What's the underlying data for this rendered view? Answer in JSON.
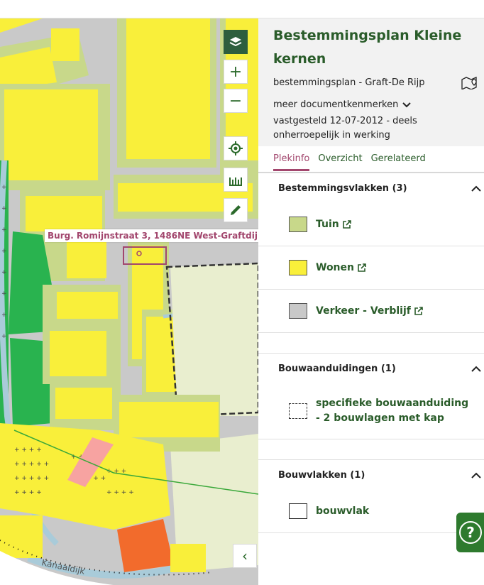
{
  "map": {
    "address_label": "Burg. Romijnstraat 3, 1486NE West-Graftdijk",
    "road_label": "Kanaaldijk",
    "controls": {
      "layers_icon": "layers-icon",
      "zoom_in_label": "+",
      "zoom_out_label": "−",
      "locate_icon": "crosshair-icon",
      "measure_icon": "ruler-icon",
      "draw_icon": "pencil-icon",
      "collapse_label": "‹"
    },
    "colors": {
      "wonen": "#f9ef3a",
      "tuin": "#c8d88a",
      "verkeer": "#c9c9c9",
      "groen": "#29b34f",
      "water": "#a9cbd9",
      "detailhandel": "#f7a3a1",
      "bedrijf": "#f26b2c",
      "agrarisch": "#e9eecf"
    }
  },
  "panel": {
    "title": "Bestemmingsplan Kleine kernen",
    "subtitle": "bestemmingsplan - Graft-De Rijp",
    "map_icon": "map-pin-icon",
    "meta_link": "meer documentkenmerken",
    "status": "vastgesteld 12-07-2012 - deels onherroepelijk in werking",
    "tabs": [
      "Plekinfo",
      "Overzicht",
      "Gerelateerd"
    ],
    "active_tab": "Plekinfo",
    "sections": [
      {
        "title": "Bestemmingsvlakken (3)",
        "items": [
          {
            "label": "Tuin",
            "color": "#c8d88a"
          },
          {
            "label": "Wonen",
            "color": "#f9ef3a"
          },
          {
            "label": "Verkeer - Verblijf",
            "color": "#c9c9c9"
          }
        ]
      },
      {
        "title": "Bouwaanduidingen (1)",
        "items": [
          {
            "label": "specifieke bouwaanduiding - 2 bouwlagen met kap",
            "color": "#ffffff"
          }
        ]
      },
      {
        "title": "Bouwvlakken (1)",
        "items": [
          {
            "label": "bouwvlak",
            "color": "#ffffff"
          }
        ]
      }
    ],
    "help_label": "?"
  }
}
